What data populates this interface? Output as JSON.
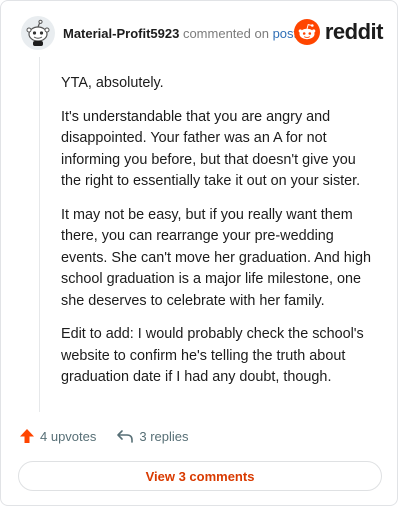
{
  "header": {
    "username": "Material-Profit5923",
    "commented_text": "commented on",
    "post_link": "post",
    "brand": "reddit",
    "avatar_icon": "snoo-avatar-icon",
    "brand_icon": "reddit-logo-icon",
    "brand_color": "#ff4500"
  },
  "comment": {
    "paragraphs": [
      "YTA, absolutely.",
      "It's understandable that you are angry and disappointed. Your father was an A for not informing you before, but that doesn't give you the right to essentially take it out on your sister.",
      "It may not be easy, but if you really want them there, you can rearrange your pre-wedding events. She can't move her graduation. And high school graduation is a major life milestone, one she deserves to celebrate with her family.",
      "Edit to add: I would probably check the school's website to confirm he's telling the truth about graduation date if I had any doubt, though."
    ]
  },
  "actions": {
    "upvotes": "4 upvotes",
    "replies": "3 replies",
    "upvote_icon": "upvote-arrow-icon",
    "reply_icon": "reply-arrow-icon",
    "upvote_color": "#ff4500"
  },
  "footer": {
    "view_comments": "View 3 comments",
    "accent": "#d93a00"
  }
}
